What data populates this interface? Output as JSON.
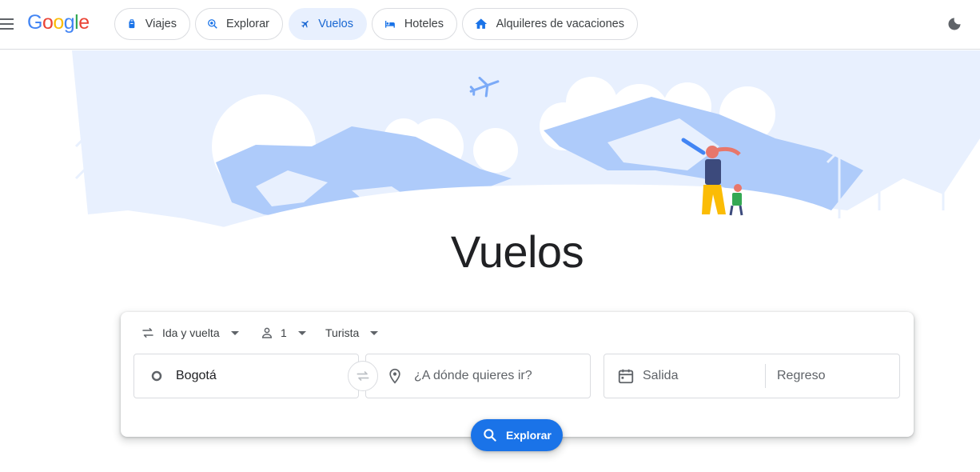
{
  "nav": {
    "chips": [
      {
        "label": "Viajes",
        "icon": "luggage-icon"
      },
      {
        "label": "Explorar",
        "icon": "explore-icon"
      },
      {
        "label": "Vuelos",
        "icon": "flight-icon",
        "active": true
      },
      {
        "label": "Hoteles",
        "icon": "hotel-icon"
      },
      {
        "label": "Alquileres de vacaciones",
        "icon": "house-icon"
      }
    ]
  },
  "hero": {
    "title": "Vuelos"
  },
  "search": {
    "trip_type": "Ida y vuelta",
    "passengers": "1",
    "cabin_class": "Turista",
    "origin": "Bogotá",
    "destination_placeholder": "¿A dónde quieres ir?",
    "departure_placeholder": "Salida",
    "return_placeholder": "Regreso",
    "explore_label": "Explorar"
  },
  "colors": {
    "accent": "#1a73e8",
    "hero_sky": "#e8f0fe",
    "mountain": "#aecbfa"
  }
}
